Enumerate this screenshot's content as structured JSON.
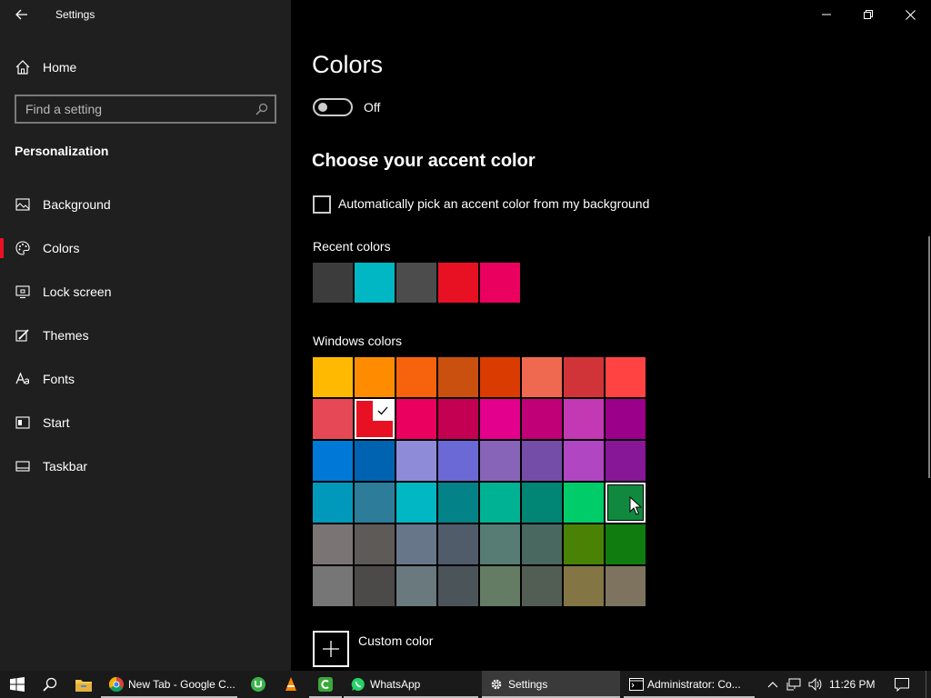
{
  "window": {
    "title": "Settings"
  },
  "sidebar": {
    "home_label": "Home",
    "search_placeholder": "Find a setting",
    "section_title": "Personalization",
    "items": [
      {
        "label": "Background",
        "icon": "image-icon",
        "active": false
      },
      {
        "label": "Colors",
        "icon": "palette-icon",
        "active": true
      },
      {
        "label": "Lock screen",
        "icon": "lock-screen-icon",
        "active": false
      },
      {
        "label": "Themes",
        "icon": "brush-icon",
        "active": false
      },
      {
        "label": "Fonts",
        "icon": "font-icon",
        "active": false
      },
      {
        "label": "Start",
        "icon": "start-icon",
        "active": false
      },
      {
        "label": "Taskbar",
        "icon": "taskbar-icon",
        "active": false
      }
    ]
  },
  "main": {
    "page_title": "Colors",
    "toggle_state": "Off",
    "accent_heading": "Choose your accent color",
    "auto_pick_label": "Automatically pick an accent color from my background",
    "recent_label": "Recent colors",
    "recent_colors": [
      "#3c3c3c",
      "#00b7c3",
      "#4c4c4c",
      "#e81123",
      "#ea005e"
    ],
    "windows_label": "Windows colors",
    "windows_colors": [
      [
        "#ffb900",
        "#ff8c00",
        "#f7630c",
        "#ca5010",
        "#da3b01",
        "#ef6950",
        "#d13438",
        "#ff4343"
      ],
      [
        "#e74856",
        "#e81123",
        "#ea005e",
        "#c30052",
        "#e3008c",
        "#bf0077",
        "#c239b3",
        "#9a0089"
      ],
      [
        "#0078d7",
        "#0063b1",
        "#8e8cd8",
        "#6b69d6",
        "#8764b8",
        "#744da9",
        "#b146c2",
        "#881798"
      ],
      [
        "#0099bc",
        "#2d7d9a",
        "#00b7c3",
        "#038387",
        "#00b294",
        "#018574",
        "#00cc6a",
        "#10893e"
      ],
      [
        "#7a7574",
        "#5d5a58",
        "#68768a",
        "#515c6b",
        "#567c73",
        "#486860",
        "#498205",
        "#107c10"
      ],
      [
        "#767676",
        "#4c4a48",
        "#69797e",
        "#4a5459",
        "#647c64",
        "#525e54",
        "#847545",
        "#7e735f"
      ]
    ],
    "selected_color": {
      "row": 1,
      "col": 1
    },
    "hovered_color": {
      "row": 3,
      "col": 7
    },
    "custom_label": "Custom color"
  },
  "taskbar": {
    "apps": [
      {
        "label": "New Tab - Google C...",
        "icon": "chrome-icon"
      },
      {
        "label": "WhatsApp",
        "icon": "whatsapp-icon"
      },
      {
        "label": "Settings",
        "icon": "gear-icon"
      },
      {
        "label": "Administrator:  Co...",
        "icon": "cmd-icon"
      }
    ],
    "time": "11:26 PM"
  }
}
